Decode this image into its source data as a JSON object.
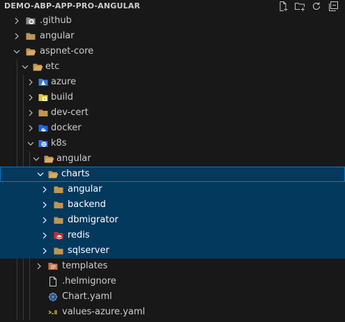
{
  "explorer": {
    "title": "DEMO-ABP-APP-PRO-ANGULAR",
    "actions": [
      "new-file-icon",
      "new-folder-icon",
      "refresh-icon",
      "collapse-all-icon"
    ]
  },
  "tree": {
    "github": ".github",
    "angular": "angular",
    "aspnet_core": "aspnet-core",
    "etc": "etc",
    "azure": "azure",
    "build": "build",
    "dev_cert": "dev-cert",
    "docker": "docker",
    "k8s": "k8s",
    "k8s_angular": "angular",
    "charts": "charts",
    "charts_angular": "angular",
    "backend": "backend",
    "dbmigrator": "dbmigrator",
    "redis": "redis",
    "sqlserver": "sqlserver",
    "templates": "templates",
    "helmignore": ".helmignore",
    "chart_yaml": "Chart.yaml",
    "values_azure": "values-azure.yaml"
  },
  "colors": {
    "background": "#181818",
    "selection": "#04395e",
    "focus_border": "#0078d4",
    "folder": "#c09553",
    "text": "#cccccc"
  }
}
